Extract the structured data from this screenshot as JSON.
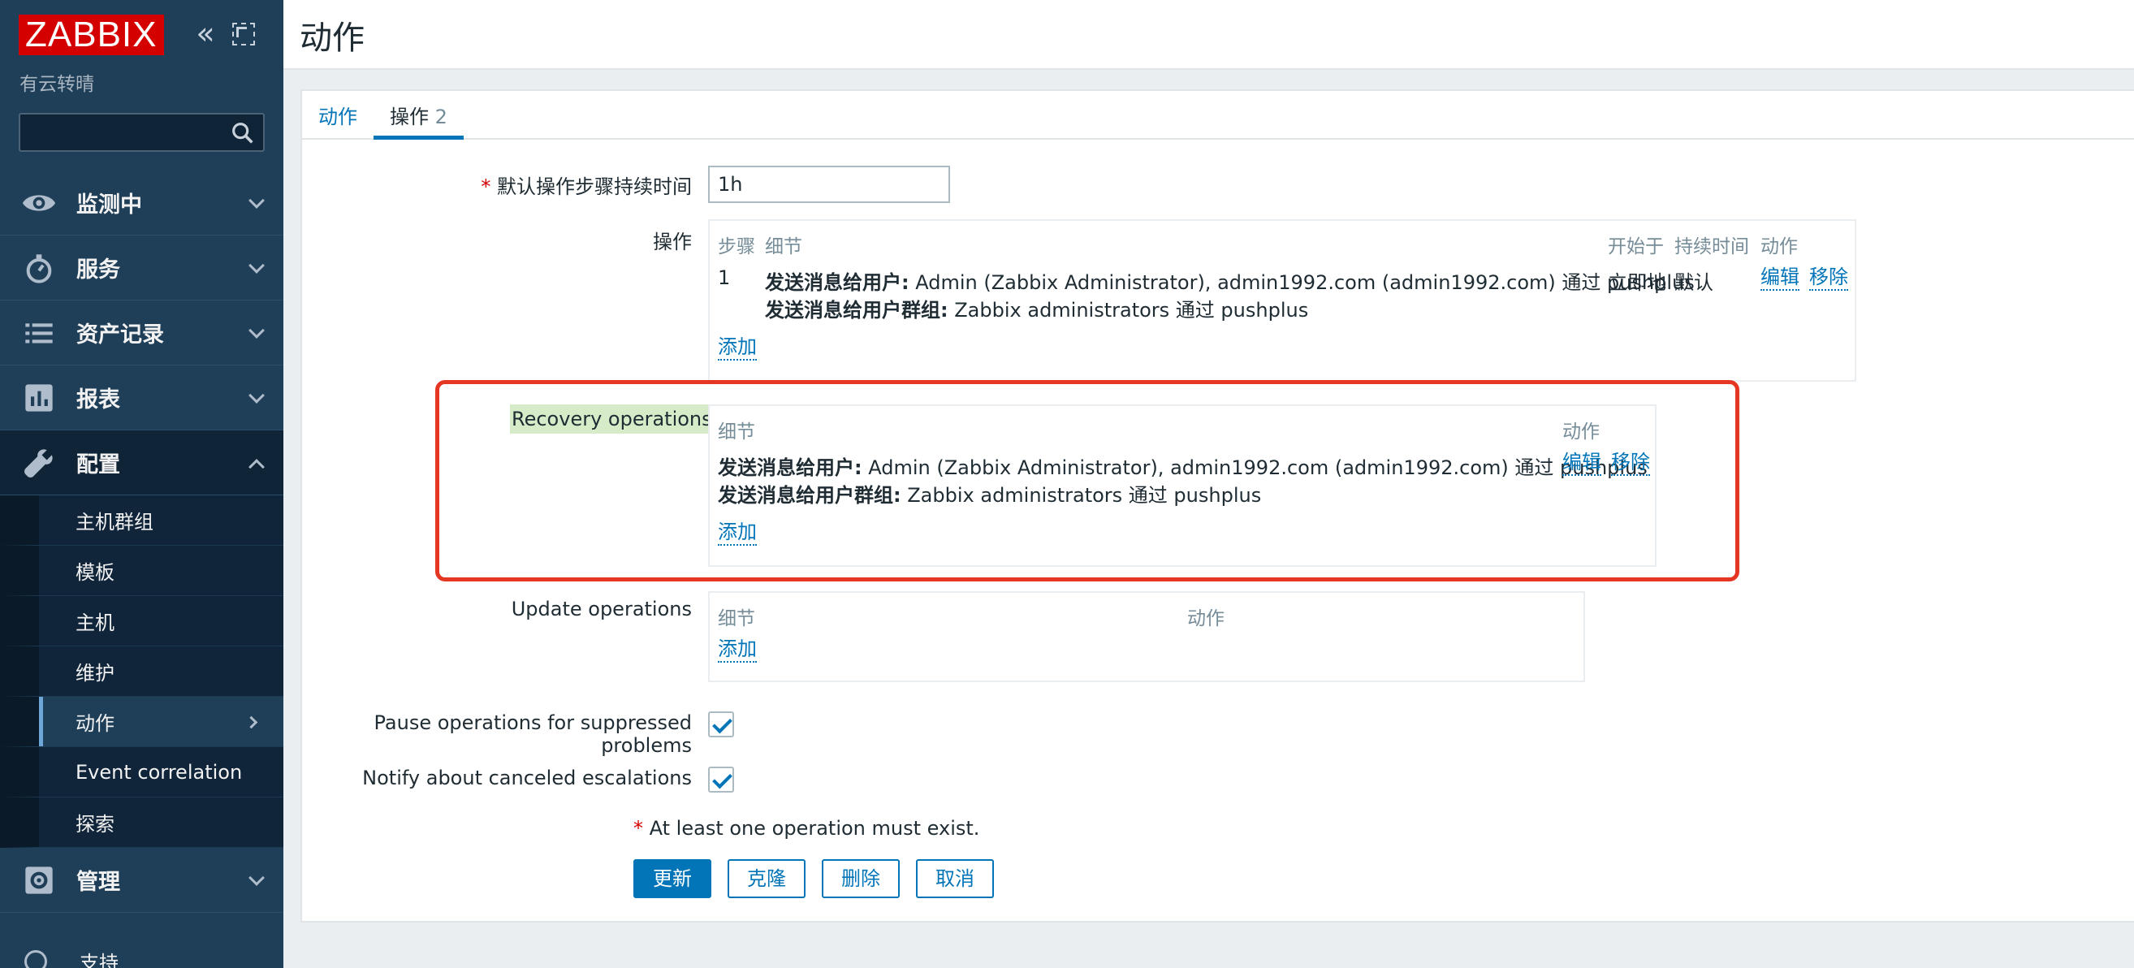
{
  "sidebar": {
    "logo": "ZABBIX",
    "server_name": "有云转晴",
    "search_placeholder": "",
    "menu": [
      {
        "label": "监测中"
      },
      {
        "label": "服务"
      },
      {
        "label": "资产记录"
      },
      {
        "label": "报表"
      },
      {
        "label": "配置"
      }
    ],
    "config_submenu": [
      "主机群组",
      "模板",
      "主机",
      "维护",
      "动作",
      "Event correlation",
      "探索"
    ],
    "admin": "管理",
    "support": "支持"
  },
  "header": {
    "title": "动作"
  },
  "tabs": [
    {
      "label": "动作"
    },
    {
      "label": "操作",
      "count": "2"
    }
  ],
  "form": {
    "step_duration_label": "默认操作步骤持续时间",
    "step_duration_value": "1h",
    "operations": {
      "label": "操作",
      "columns": {
        "steps": "步骤",
        "details": "细节",
        "start": "开始于",
        "duration": "持续时间",
        "action": "动作"
      },
      "row": {
        "step": "1",
        "line1_bold": "发送消息给用户:",
        "line1_text": " Admin (Zabbix Administrator), admin1992.com (admin1992.com) 通过 pushplus",
        "line2_bold": "发送消息给用户群组:",
        "line2_text": " Zabbix administrators 通过 pushplus",
        "start": "立即地",
        "duration": "默认",
        "edit": "编辑",
        "remove": "移除"
      },
      "add": "添加"
    },
    "recovery": {
      "label": "Recovery operations",
      "columns": {
        "details": "细节",
        "action": "动作"
      },
      "row": {
        "line1_bold": "发送消息给用户:",
        "line1_text": " Admin (Zabbix Administrator), admin1992.com (admin1992.com) 通过 pushplus",
        "line2_bold": "发送消息给用户群组:",
        "line2_text": " Zabbix administrators 通过 pushplus",
        "edit": "编辑",
        "remove": "移除"
      },
      "add": "添加"
    },
    "update": {
      "label": "Update operations",
      "columns": {
        "details": "细节",
        "action": "动作"
      },
      "add": "添加"
    },
    "pause_label": "Pause operations for suppressed problems",
    "notify_label": "Notify about canceled escalations",
    "note": "At least one operation must exist.",
    "buttons": {
      "update": "更新",
      "clone": "克隆",
      "delete": "删除",
      "cancel": "取消"
    }
  },
  "colors": {
    "accent": "#0275b8",
    "sidebar": "#1f3f58",
    "logo": "#d40000",
    "highlight": "#e53623"
  }
}
